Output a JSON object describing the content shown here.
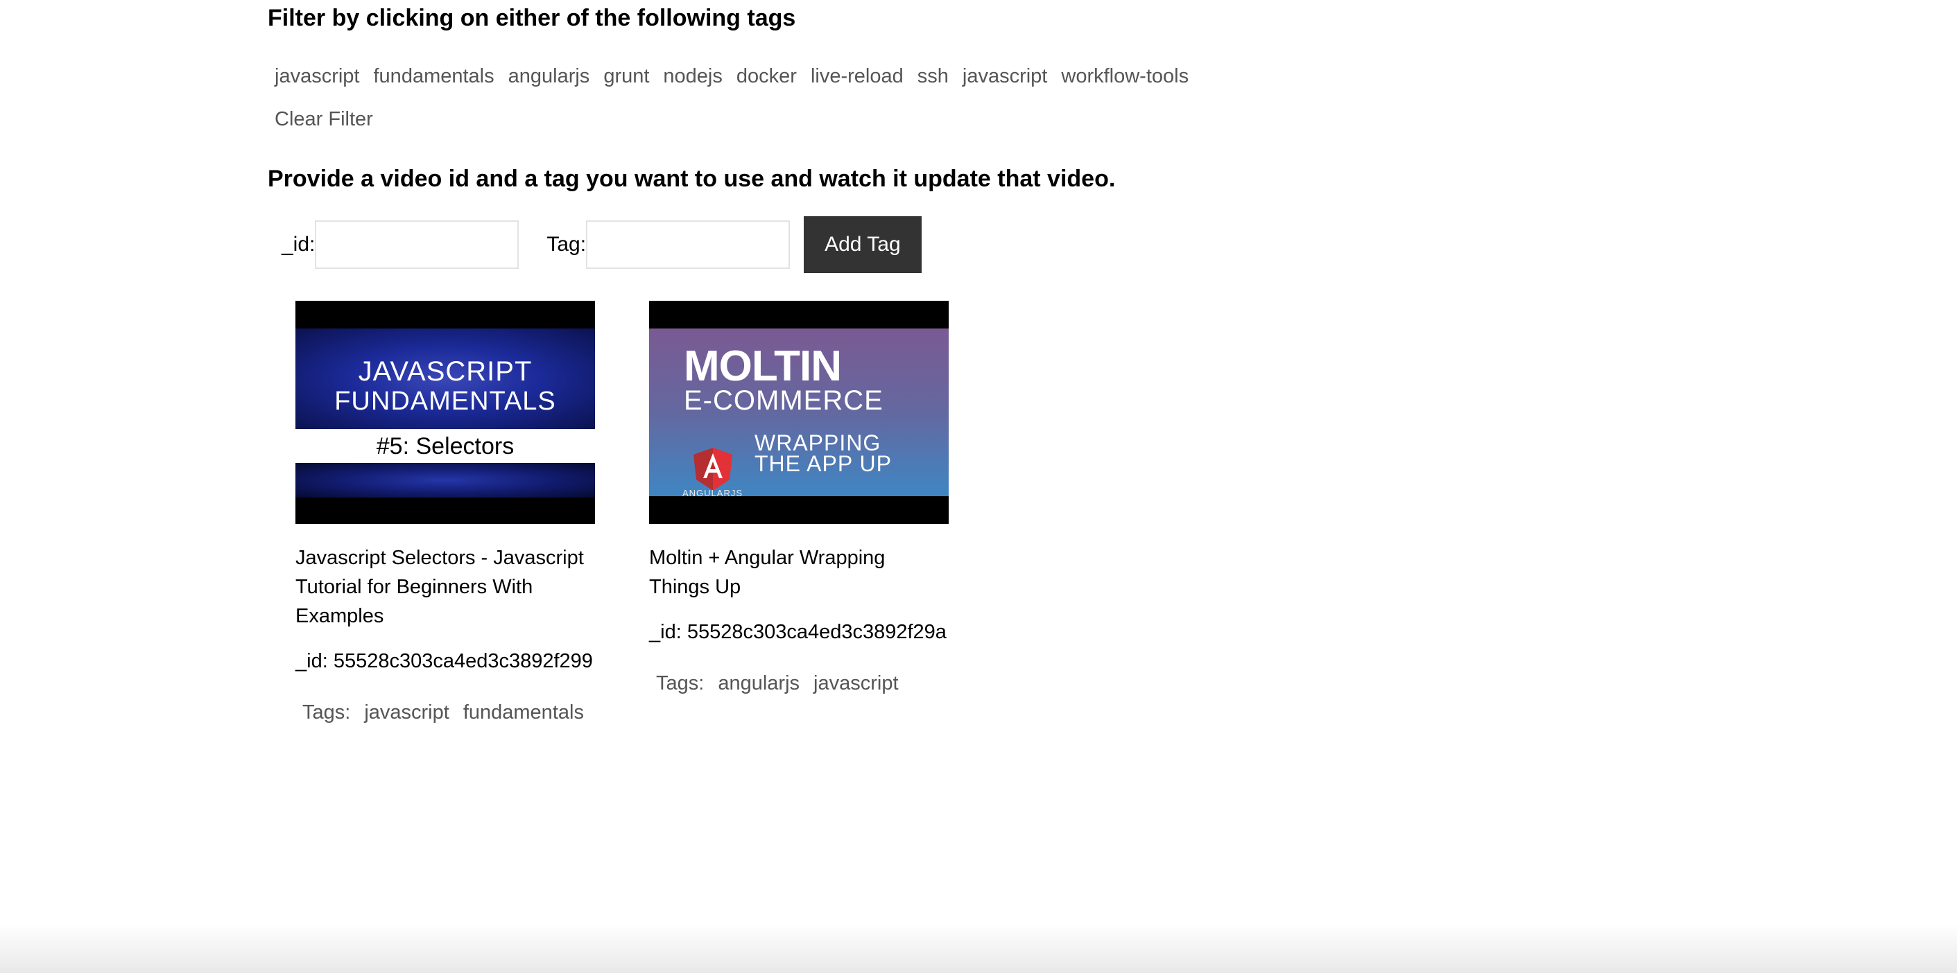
{
  "filter": {
    "heading": "Filter by clicking on either of the following tags",
    "tags": [
      "javascript",
      "fundamentals",
      "angularjs",
      "grunt",
      "nodejs",
      "docker",
      "live-reload",
      "ssh",
      "javascript",
      "workflow-tools"
    ],
    "clear_label": "Clear Filter"
  },
  "update": {
    "heading": "Provide a video id and a tag you want to use and watch it update that video.",
    "id_label": "_id:",
    "id_value": "",
    "tag_label": "Tag:",
    "tag_value": "",
    "button_label": "Add Tag",
    "button_color": "#333333"
  },
  "videos": [
    {
      "thumbnail": {
        "line1": "JAVASCRIPT",
        "line2": "FUNDAMENTALS",
        "line3": "#5: Selectors"
      },
      "title": "Javascript Selectors - Javascript Tutorial for Beginners With Examples",
      "id_text": "_id: 55528c303ca4ed3c3892f299",
      "tags_label": "Tags:",
      "tags": [
        "javascript",
        "fundamentals"
      ]
    },
    {
      "thumbnail": {
        "line1": "MOLTIN",
        "line2": "E-COMMERCE",
        "line3": "WRAPPING",
        "line4": "THE APP UP",
        "logo_text": "ANGULARJS"
      },
      "title": "Moltin + Angular Wrapping Things Up",
      "id_text": "_id: 55528c303ca4ed3c3892f29a",
      "tags_label": "Tags:",
      "tags": [
        "angularjs",
        "javascript"
      ]
    }
  ],
  "colors": {
    "text": "#000000",
    "tag_text": "#555555",
    "button_bg": "#333333",
    "button_text": "#ffffff"
  }
}
